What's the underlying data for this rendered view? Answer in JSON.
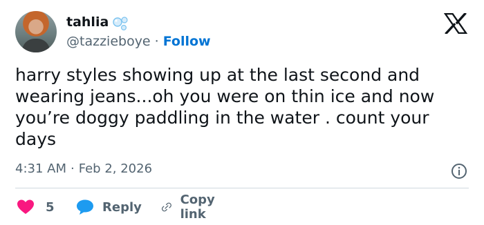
{
  "user": {
    "name": "tahlia",
    "handle": "@tazzieboye",
    "separator": "·",
    "follow_label": "Follow"
  },
  "tweet": {
    "text": "harry styles showing up at the last second and\nwearing jeans...oh you were on thin ice and now\nyou’re doggy paddling in the water . count your\ndays",
    "time": "4:31 AM",
    "separator": "·",
    "date": "Feb 2, 2026"
  },
  "actions": {
    "like_count": "5",
    "reply_label": "Reply",
    "copy_link_label": "Copy link"
  },
  "colors": {
    "follow": "#0074d4",
    "like": "#f91880",
    "reply": "#1d9bf0",
    "secondary_text": "#536471",
    "divider": "#cfd9de"
  },
  "icons": {
    "brand": "x-logo-icon",
    "name_emoji": "bubbles-icon",
    "info": "info-icon",
    "like": "heart-icon",
    "reply": "speech-bubble-icon",
    "copy": "link-icon"
  }
}
